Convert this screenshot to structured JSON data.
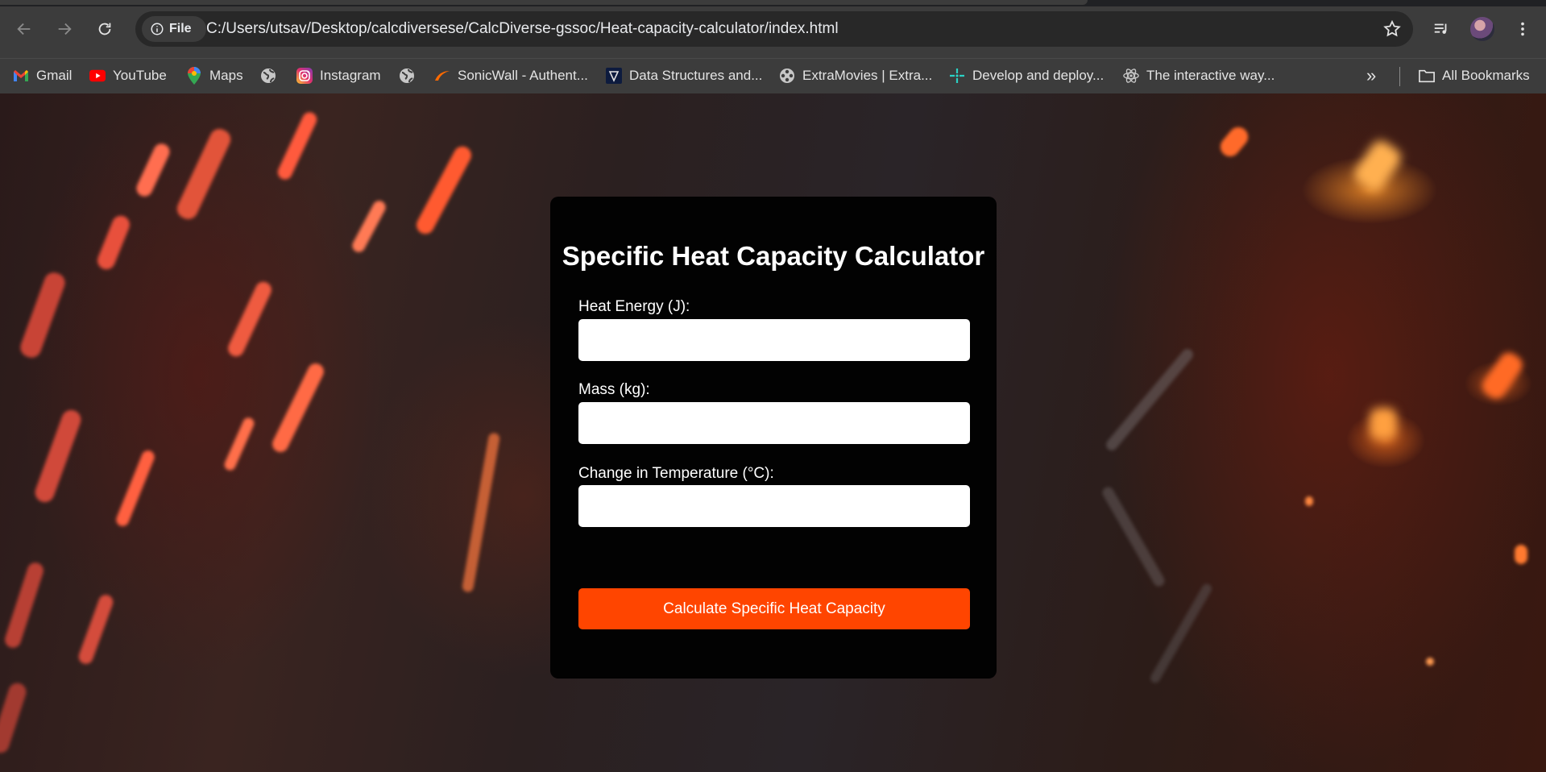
{
  "browser": {
    "url": "C:/Users/utsav/Desktop/calcdiversese/CalcDiverse-gssoc/Heat-capacity-calculator/index.html",
    "scheme_chip": "File",
    "bookmarks": [
      {
        "label": "Gmail",
        "icon": "gmail-icon"
      },
      {
        "label": "YouTube",
        "icon": "youtube-icon"
      },
      {
        "label": "Maps",
        "icon": "maps-icon"
      },
      {
        "label": "",
        "icon": "globe-icon"
      },
      {
        "label": "Instagram",
        "icon": "instagram-icon"
      },
      {
        "label": "",
        "icon": "globe-icon"
      },
      {
        "label": "SonicWall - Authent...",
        "icon": "sonicwall-icon"
      },
      {
        "label": "Data Structures and...",
        "icon": "site-icon"
      },
      {
        "label": "ExtraMovies | Extra...",
        "icon": "film-reel-icon"
      },
      {
        "label": "Develop and deploy...",
        "icon": "sparkle-icon"
      },
      {
        "label": "The interactive way...",
        "icon": "react-icon"
      }
    ],
    "overflow_label": "»",
    "all_bookmarks_label": "All Bookmarks"
  },
  "calculator": {
    "title": "Specific Heat Capacity Calculator",
    "fields": [
      {
        "label": "Heat Energy (J):",
        "value": "",
        "placeholder": ""
      },
      {
        "label": "Mass (kg):",
        "value": "",
        "placeholder": ""
      },
      {
        "label": "Change in Temperature (°C):",
        "value": "",
        "placeholder": ""
      }
    ],
    "button_label": "Calculate Specific Heat Capacity"
  },
  "colors": {
    "accent_button": "#ff4500",
    "card_background": "#020202",
    "browser_toolbar": "#3c3c3c"
  }
}
